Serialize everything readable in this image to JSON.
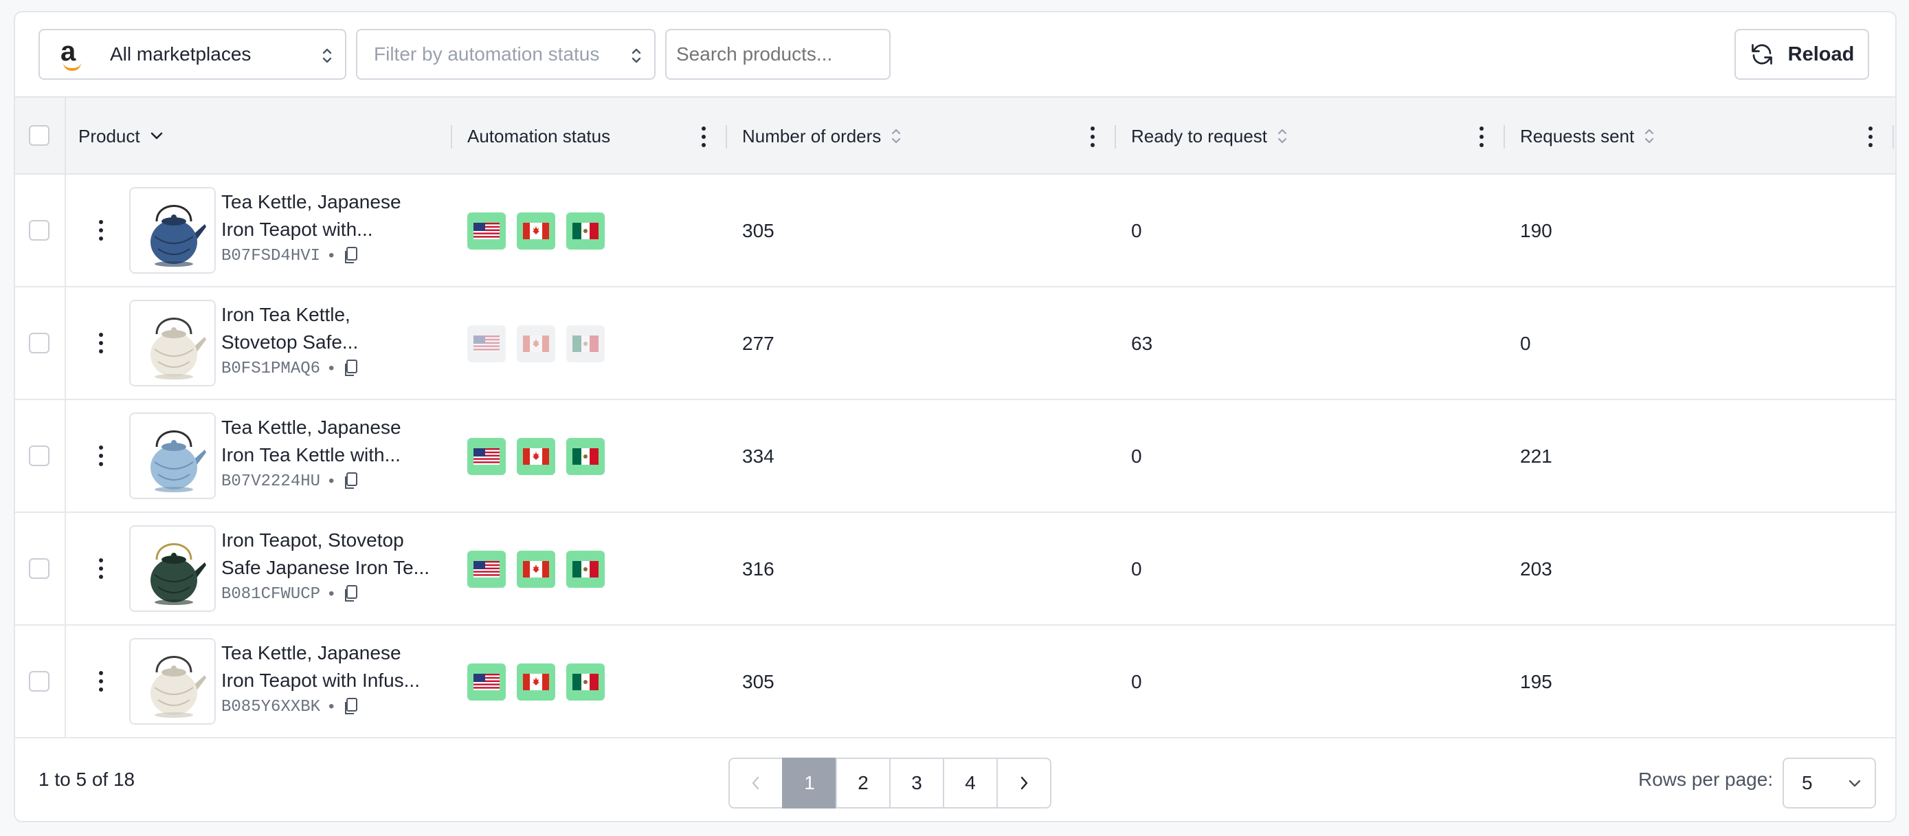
{
  "toolbar": {
    "marketplace_logo": "a",
    "marketplace": "All marketplaces",
    "automation_filter_placeholder": "Filter by automation status",
    "search_placeholder": "Search products...",
    "reload_label": "Reload"
  },
  "table": {
    "headers": {
      "product": "Product",
      "automation": "Automation status",
      "orders": "Number of orders",
      "ready": "Ready to request",
      "sent": "Requests sent"
    },
    "rows": [
      {
        "name_line1": "Tea Kettle, Japanese",
        "name_line2": "Iron Teapot with...",
        "asin": "B07FSD4HVI",
        "automation_active": true,
        "orders": "305",
        "ready": "0",
        "sent": "190",
        "image": "blue-twisted-teapot"
      },
      {
        "name_line1": "Iron Tea Kettle,",
        "name_line2": "Stovetop Safe...",
        "asin": "B0FS1PMAQ6",
        "automation_active": false,
        "orders": "277",
        "ready": "63",
        "sent": "0",
        "image": "white-teapot"
      },
      {
        "name_line1": "Tea Kettle, Japanese",
        "name_line2": "Iron Tea Kettle with...",
        "asin": "B07V2224HU",
        "automation_active": true,
        "orders": "334",
        "ready": "0",
        "sent": "221",
        "image": "light-blue-teapot"
      },
      {
        "name_line1": "Iron Teapot, Stovetop",
        "name_line2": "Safe Japanese Iron Te...",
        "asin": "B081CFWUCP",
        "automation_active": true,
        "orders": "316",
        "ready": "0",
        "sent": "203",
        "image": "green-geometric-teapot"
      },
      {
        "name_line1": "Tea Kettle, Japanese",
        "name_line2": "Iron Teapot with Infus...",
        "asin": "B085Y6XXBK",
        "automation_active": true,
        "orders": "305",
        "ready": "0",
        "sent": "195",
        "image": "white-teapot"
      }
    ],
    "flags": [
      "us-flag",
      "ca-flag",
      "mx-flag"
    ]
  },
  "footer": {
    "range_text": "1 to 5 of 18",
    "pages": [
      "1",
      "2",
      "3",
      "4"
    ],
    "current_page": "1",
    "rows_per_page_label": "Rows per page:",
    "rows_per_page": "5"
  },
  "colors": {
    "flag_active_bg": "#7ee0a0",
    "flag_inactive_bg": "#f0f1f3",
    "active_page_bg": "#9ca3af"
  }
}
